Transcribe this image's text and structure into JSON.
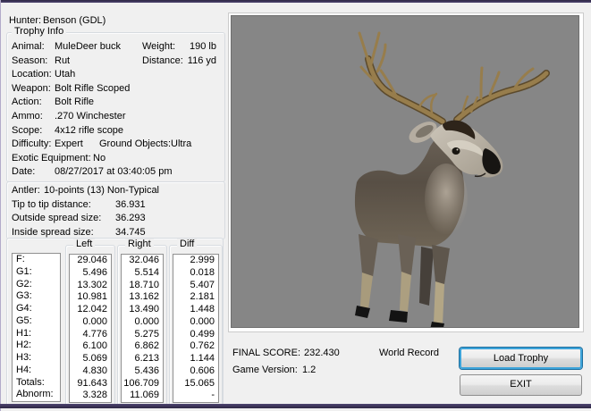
{
  "hunter": {
    "label": "Hunter:",
    "value": "Benson (GDL)"
  },
  "trophy_info": {
    "title": "Trophy Info",
    "rows": [
      {
        "label": "Animal:",
        "value": "MuleDeer buck",
        "label2": "Weight:",
        "value2": "190 lb"
      },
      {
        "label": "Season:",
        "value": "Rut",
        "label2": "Distance:",
        "value2": "116 yd"
      },
      {
        "label": "Location:",
        "value": "Utah"
      },
      {
        "label": "Weapon:",
        "value": "Bolt Rifle Scoped"
      },
      {
        "label": "Action:",
        "value": "Bolt Rifle"
      },
      {
        "label": "Ammo:",
        "value": ".270 Winchester"
      },
      {
        "label": "Scope:",
        "value": "4x12 rifle scope"
      },
      {
        "label": "Difficulty:",
        "value": "Expert",
        "label2": "Ground Objects:",
        "value2": "Ultra"
      },
      {
        "label": "Exotic Equipment:",
        "value": "No"
      },
      {
        "label": "Date:",
        "value": "08/27/2017 at 03:40:05 pm"
      }
    ]
  },
  "antler_info": {
    "rows": [
      {
        "label": "Antler:",
        "value": "10-points (13) Non-Typical"
      },
      {
        "label": "Tip to tip distance:",
        "value": "36.931"
      },
      {
        "label": "Outside spread size:",
        "value": "36.293"
      },
      {
        "label": "Inside spread size:",
        "value": "34.745"
      }
    ]
  },
  "measurements": {
    "row_labels": [
      "F:",
      "G1:",
      "G2:",
      "G3:",
      "G4:",
      "G5:",
      "H1:",
      "H2:",
      "H3:",
      "H4:",
      "Totals:",
      "Abnorm:"
    ],
    "columns": [
      {
        "header": "Left",
        "values": [
          "29.046",
          "5.496",
          "13.302",
          "10.981",
          "12.042",
          "0.000",
          "4.776",
          "6.100",
          "5.069",
          "4.830",
          "91.643",
          "3.328"
        ]
      },
      {
        "header": "Right",
        "values": [
          "32.046",
          "5.514",
          "18.710",
          "13.162",
          "13.490",
          "0.000",
          "5.275",
          "6.862",
          "6.213",
          "5.436",
          "106.709",
          "11.069"
        ]
      },
      {
        "header": "Diff",
        "values": [
          "2.999",
          "0.018",
          "5.407",
          "2.181",
          "1.448",
          "0.000",
          "0.499",
          "0.762",
          "1.144",
          "0.606",
          "15.065",
          "-"
        ]
      }
    ]
  },
  "viewer": {
    "background_color": "#868686",
    "subject": "MuleDeer buck 3D render"
  },
  "score": {
    "final_label": "FINAL SCORE:",
    "final_value": "232.430",
    "record_text": "World Record",
    "version_label": "Game Version:",
    "version_value": "1.2"
  },
  "buttons": {
    "load_trophy": "Load Trophy",
    "exit": "EXIT"
  }
}
